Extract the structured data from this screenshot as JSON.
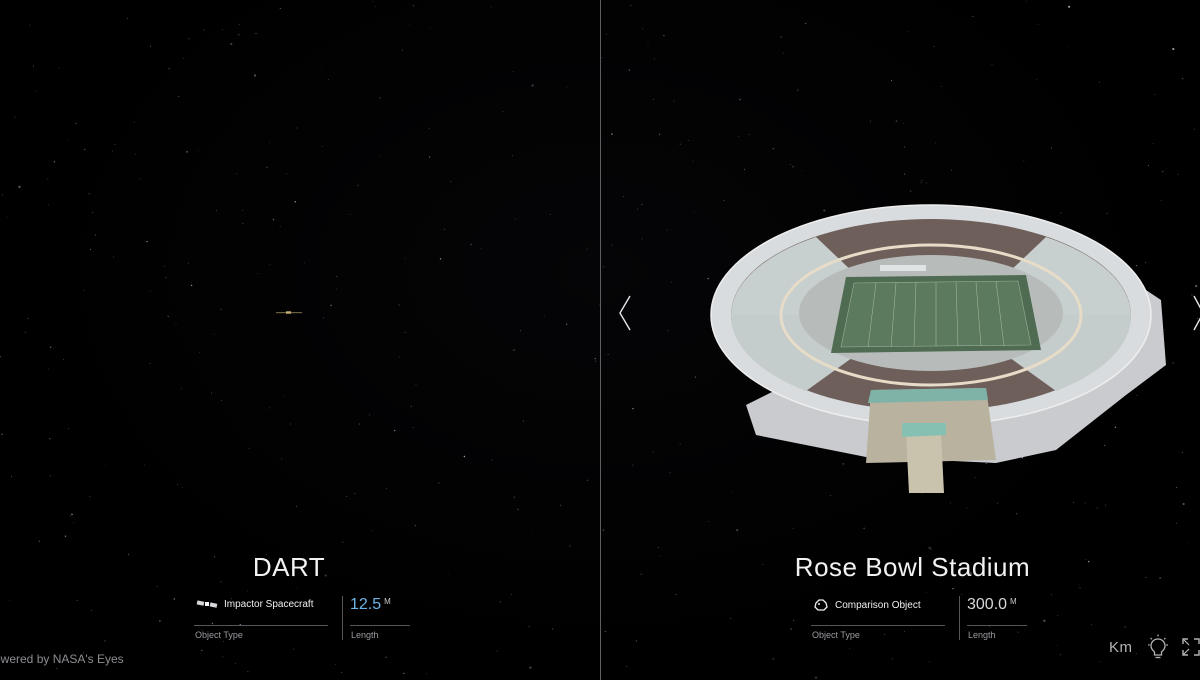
{
  "left_object": {
    "name": "DART",
    "type_icon": "spacecraft-icon",
    "type_value": "Impactor Spacecraft",
    "type_label": "Object Type",
    "length_value": "12.5",
    "length_unit": "M",
    "length_label": "Length"
  },
  "right_object": {
    "name": "Rose Bowl Stadium",
    "type_icon": "comparison-object-icon",
    "type_value": "Comparison Object",
    "type_label": "Object Type",
    "length_value": "300.0",
    "length_unit": "M",
    "length_label": "Length"
  },
  "footer": {
    "powered_by": "owered by NASA's Eyes"
  },
  "controls": {
    "unit_toggle": "Km",
    "light_icon": "lightbulb-icon",
    "expand_icon": "expand-icon",
    "prev_icon": "chevron-left-icon",
    "next_icon": "chevron-right-icon"
  },
  "colors": {
    "background": "#000000",
    "divider": "#5d5d62",
    "accent_blue": "#6fb4e6",
    "label_gray": "#9b9ba0"
  }
}
